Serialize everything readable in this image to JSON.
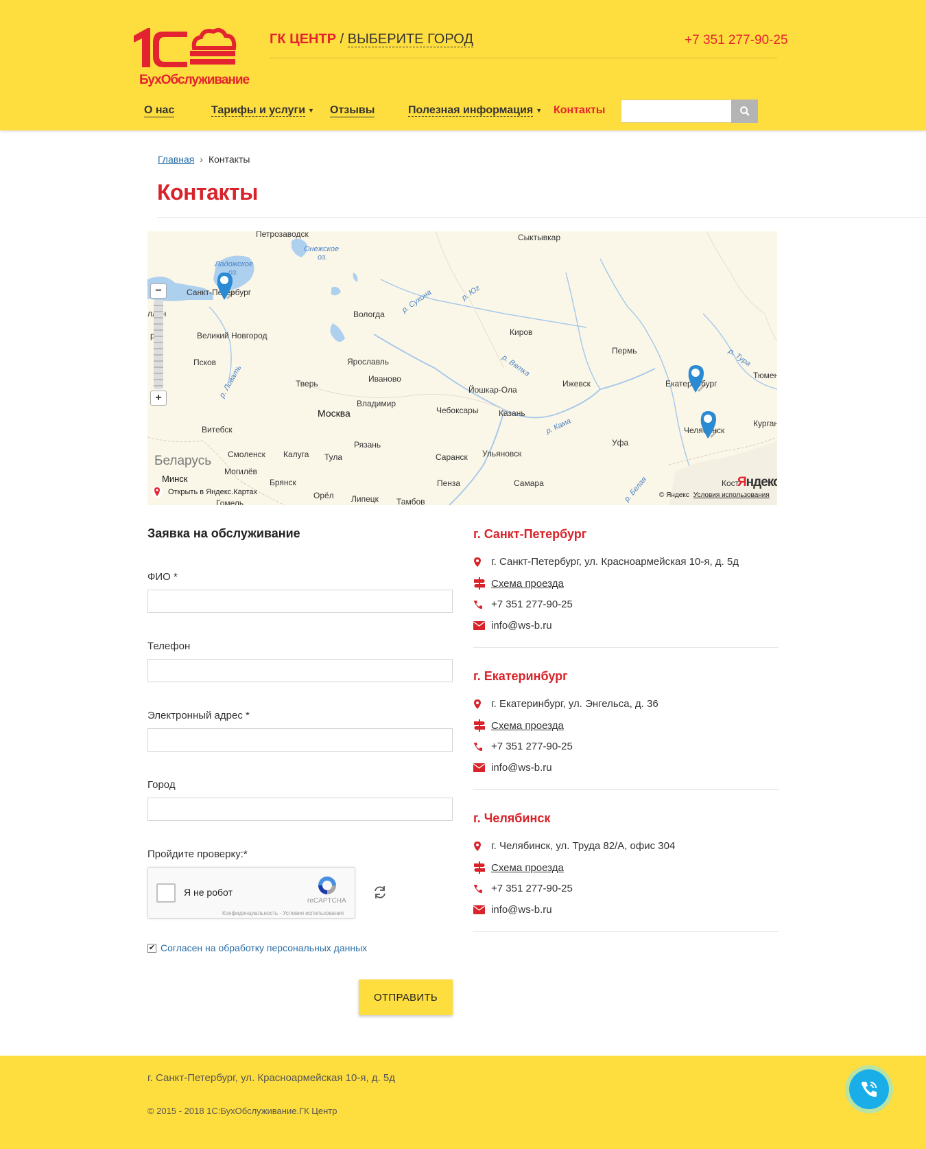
{
  "header": {
    "logo_sub": "БухОбслуживание",
    "company_brand": "ГК ЦЕНТР",
    "company_sep": " / ",
    "city_select": "ВЫБЕРИТЕ ГОРОД",
    "phone": "+7 351 277-90-25",
    "nav": [
      {
        "label": "О нас"
      },
      {
        "label": "Тарифы и услуги"
      },
      {
        "label": "Отзывы"
      },
      {
        "label": "Полезная информация"
      },
      {
        "label": "Контакты"
      }
    ],
    "search_placeholder": ""
  },
  "breadcrumb": {
    "home": "Главная",
    "current": "Контакты"
  },
  "page_title": "Контакты",
  "map": {
    "cities": {
      "petrozavodsk": "Петрозаводск",
      "syktyvkar": "Сыктывкар",
      "spb": "Санкт-Петербург",
      "tallinn": "ллин",
      "vologda": "Вологда",
      "kirov": "Киров",
      "perm": "Пермь",
      "vnovgorod": "Великий Новгород",
      "pskov": "Псков",
      "yaroslavl": "Ярославль",
      "ivanovo": "Иваново",
      "tver": "Тверь",
      "yoshkar": "Йошкар-Ола",
      "izhevsk": "Ижевск",
      "ekb": "Екатеринбург",
      "tyumen": "Тюмень",
      "vladimir": "Владимир",
      "moscow": "Москва",
      "cheboksary": "Чебоксары",
      "kazan": "Казань",
      "vitebsk": "Витебск",
      "chel": "Челябинск",
      "kurgan": "Курган",
      "smolensk": "Смоленск",
      "kaluga": "Калуга",
      "tula": "Тула",
      "ryazan": "Рязань",
      "saransk": "Саранск",
      "ulyanovsk": "Ульяновск",
      "ufa": "Уфа",
      "mogilev": "Могилёв",
      "minsk": "Минск",
      "bryansk": "Брянск",
      "penza": "Пенза",
      "samara": "Самара",
      "orel": "Орёл",
      "lipetsk": "Липецк",
      "tambov": "Тамбов",
      "gomel": "Гомель",
      "kost": "Кост",
      "riga": "ри",
      "dvinsk": "у"
    },
    "country": "Беларусь",
    "lakes": {
      "onega_1": "Онежское",
      "onega_2": "оз.",
      "ladoga_1": "Ладожское",
      "ladoga_2": "оз."
    },
    "rivers": {
      "sukhona": "р. Сухона",
      "yug": "р. Юг",
      "vyatka": "р. Вятка",
      "tura": "р. Тура",
      "lovat": "р. Ловать",
      "kama": "р. Кама",
      "belaya": "р. Белая"
    },
    "zoom_out": "−",
    "zoom_in": "+",
    "open_link": "Открыть в Яндекс.Картах",
    "copyright": "© Яндекс",
    "terms": "Условия использования",
    "logo_y": "Я",
    "logo_rest": "ндекс"
  },
  "form": {
    "title": "Заявка на обслуживание",
    "fields": [
      {
        "label": "ФИО *",
        "value": ""
      },
      {
        "label": "Телефон",
        "value": ""
      },
      {
        "label": "Электронный адрес *",
        "value": ""
      },
      {
        "label": "Город",
        "value": ""
      }
    ],
    "captcha_label": "Пройдите проверку:*",
    "captcha_text": "Я не робот",
    "captcha_brand": "reCAPTCHA",
    "captcha_links": "Конфиденциальность - Условия использования",
    "agree_check": "✔",
    "agree_text": "Согласен на обработку персональных данных",
    "submit": "ОТПРАВИТЬ"
  },
  "offices": [
    {
      "title": "г. Санкт-Петербург",
      "address": "г. Санкт-Петербург, ул. Красноармейская 10-я, д. 5д",
      "route": "Схема проезда",
      "phone": "+7 351 277-90-25",
      "email": "info@ws-b.ru"
    },
    {
      "title": "г. Екатеринбург",
      "address": "г. Екатеринбург, ул. Энгельса, д. 36",
      "route": "Схема проезда",
      "phone": "+7 351 277-90-25",
      "email": "info@ws-b.ru"
    },
    {
      "title": "г. Челябинск",
      "address": "г. Челябинск, ул. Труда 82/А, офис 304",
      "route": "Схема проезда",
      "phone": "+7 351 277-90-25",
      "email": "info@ws-b.ru"
    }
  ],
  "footer": {
    "address": "г. Санкт-Петербург, ул. Красноармейская 10-я, д. 5д",
    "copyright": "© 2015 - 2018 1С:БухОбслуживание.ГК Центр"
  },
  "colors": {
    "header_bg": "#fedd3e",
    "accent_red": "#d8232a",
    "link_blue": "#2a6fa8",
    "call_blue": "#1aaee8"
  }
}
